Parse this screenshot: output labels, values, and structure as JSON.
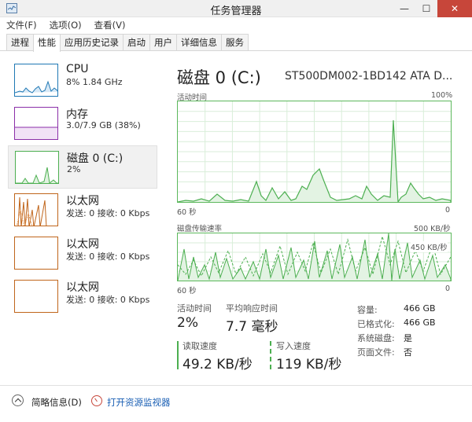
{
  "window": {
    "title": "任务管理器",
    "min_glyph": "—",
    "max_glyph": "☐",
    "close_glyph": "✕"
  },
  "menu": [
    "文件(F)",
    "选项(O)",
    "查看(V)"
  ],
  "tabs": [
    "进程",
    "性能",
    "应用历史记录",
    "启动",
    "用户",
    "详细信息",
    "服务"
  ],
  "active_tab": "性能",
  "sidebar": [
    {
      "name": "CPU",
      "sub": "8% 1.84 GHz",
      "color": "#1f78b4",
      "icon": "cpu-graph"
    },
    {
      "name": "内存",
      "sub": "3.0/7.9 GB (38%)",
      "color": "#8b2fa8",
      "icon": "memory-graph"
    },
    {
      "name": "磁盘 0 (C:)",
      "sub": "2%",
      "color": "#4caf50",
      "icon": "disk-graph"
    },
    {
      "name": "以太网",
      "sub": "发送: 0 接收: 0 Kbps",
      "color": "#c0651b",
      "icon": "ethernet-graph"
    },
    {
      "name": "以太网",
      "sub": "发送: 0 接收: 0 Kbps",
      "color": "#c0651b",
      "icon": "ethernet-graph"
    },
    {
      "name": "以太网",
      "sub": "发送: 0 接收: 0 Kbps",
      "color": "#c0651b",
      "icon": "ethernet-graph"
    }
  ],
  "main": {
    "title": "磁盘 0 (C:)",
    "model": "ST500DM002-1BD142 ATA D...",
    "graph1": {
      "label": "活动时间",
      "max": "100%",
      "left": "60 秒",
      "right": "0"
    },
    "graph2": {
      "label": "磁盘传输速率",
      "max": "500 KB/秒",
      "inner": "450 KB/秒",
      "left": "60 秒",
      "right": "0"
    },
    "stats": {
      "active_label": "活动时间",
      "active_value": "2%",
      "resp_label": "平均响应时间",
      "resp_value": "7.7 毫秒",
      "read_label": "读取速度",
      "read_value": "49.2 KB/秒",
      "write_label": "写入速度",
      "write_value": "119 KB/秒"
    },
    "props": [
      {
        "label": "容量:",
        "value": "466 GB"
      },
      {
        "label": "已格式化:",
        "value": "466 GB"
      },
      {
        "label": "系统磁盘:",
        "value": "是"
      },
      {
        "label": "页面文件:",
        "value": "否"
      }
    ]
  },
  "footer": {
    "fewer": "简略信息(D)",
    "monitor": "打开资源监视器"
  },
  "colors": {
    "disk": "#4caf50",
    "accent_link": "#1a5fb4",
    "close": "#c7463a"
  }
}
